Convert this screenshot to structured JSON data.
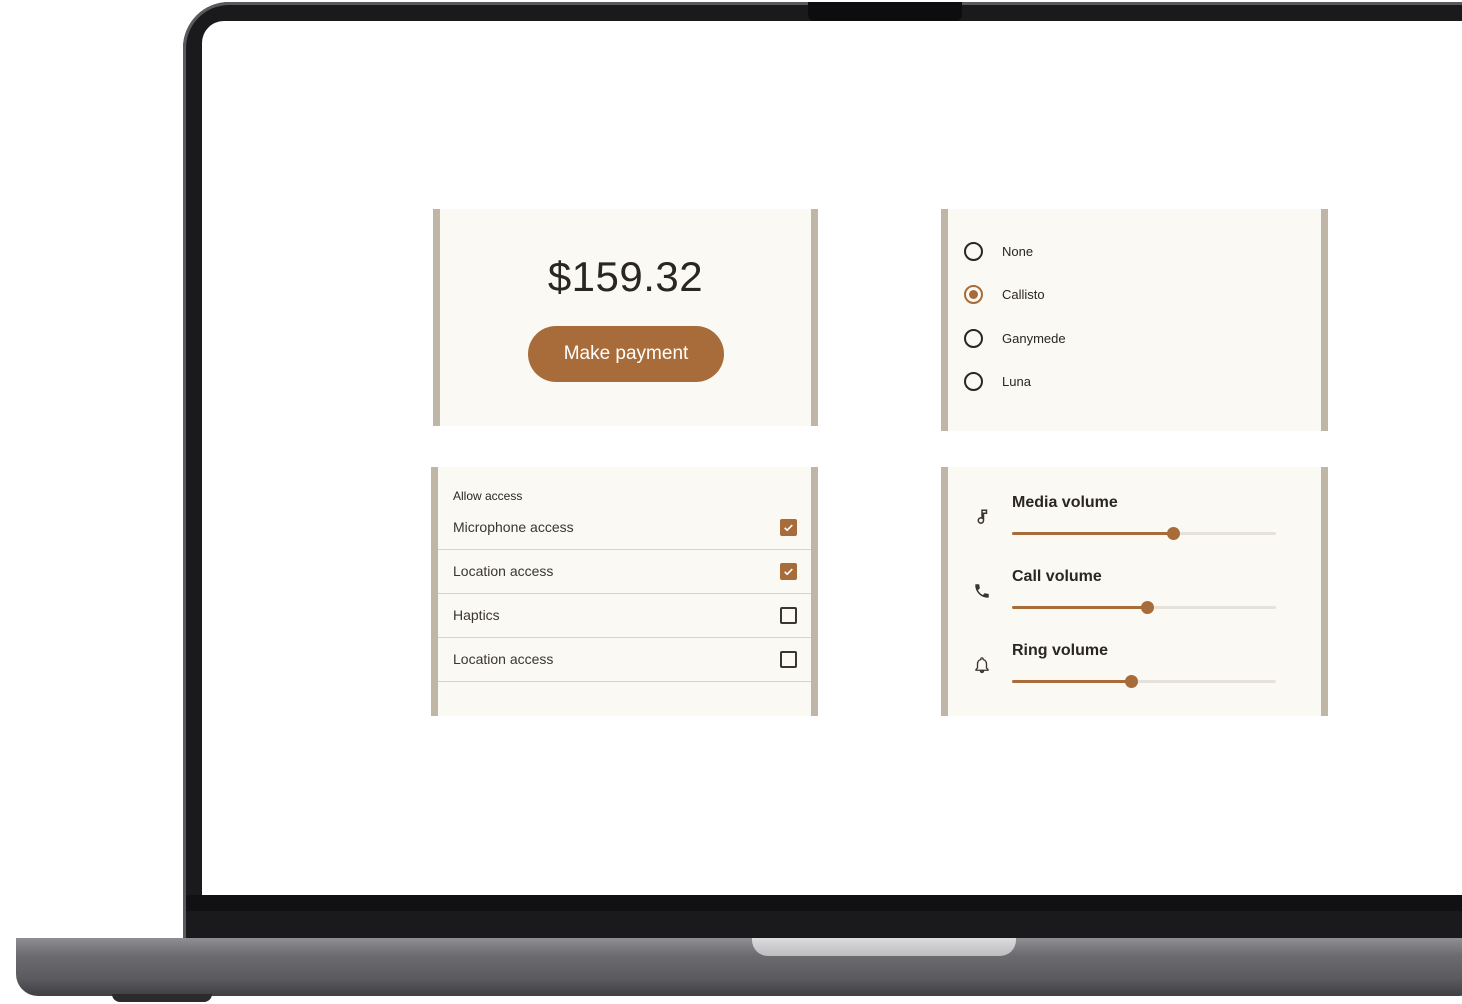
{
  "payment": {
    "amount": "$159.32",
    "button_label": "Make payment"
  },
  "radio_group": {
    "selected": "Callisto",
    "options": [
      "None",
      "Callisto",
      "Ganymede",
      "Luna"
    ]
  },
  "access": {
    "header": "Allow access",
    "items": [
      {
        "label": "Microphone access",
        "checked": true
      },
      {
        "label": "Location access",
        "checked": true
      },
      {
        "label": "Haptics",
        "checked": false
      },
      {
        "label": "Location access",
        "checked": false
      }
    ]
  },
  "volume": {
    "items": [
      {
        "label": "Media volume",
        "icon": "music-note-icon",
        "value": 0.61
      },
      {
        "label": "Call volume",
        "icon": "phone-icon",
        "value": 0.51
      },
      {
        "label": "Ring volume",
        "icon": "bell-icon",
        "value": 0.45
      }
    ]
  },
  "colors": {
    "accent": "#a86c3a",
    "card_background": "#fbf9f3",
    "card_border": "#bfb6a7"
  }
}
